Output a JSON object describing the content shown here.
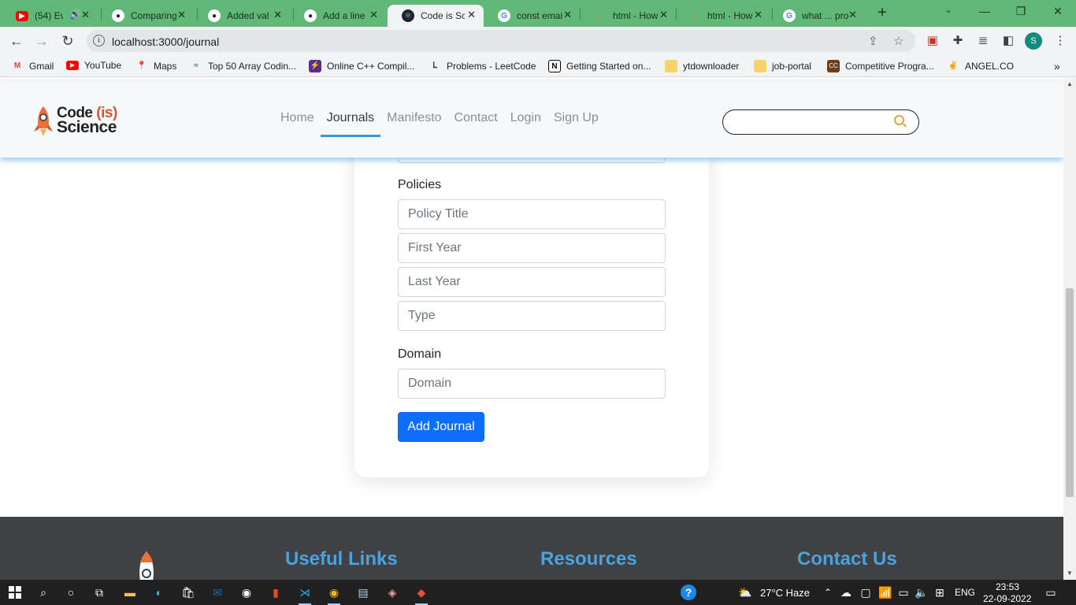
{
  "browser": {
    "tabs": [
      {
        "title": "(54) Ev",
        "icon": "youtube-icon"
      },
      {
        "title": "Comparing",
        "icon": "github-icon"
      },
      {
        "title": "Added val",
        "icon": "github-icon"
      },
      {
        "title": "Add a line",
        "icon": "github-icon"
      },
      {
        "title": "Code is Sci",
        "icon": "react-icon"
      },
      {
        "title": "const emai",
        "icon": "google-icon"
      },
      {
        "title": "html - How",
        "icon": "stackoverflow-icon"
      },
      {
        "title": "html - How",
        "icon": "stackoverflow-icon"
      },
      {
        "title": "what ... pro",
        "icon": "google-icon"
      }
    ],
    "active_tab_index": 4,
    "url": "localhost:3000/journal",
    "profile_initial": "S",
    "bookmarks": [
      {
        "label": "Gmail",
        "icon": "gmail-icon",
        "color": "#ea4335"
      },
      {
        "label": "YouTube",
        "icon": "youtube-icon",
        "color": "#ff0000"
      },
      {
        "label": "Maps",
        "icon": "maps-icon",
        "color": "#34a853"
      },
      {
        "label": "Top 50 Array Codin...",
        "icon": "gfg-icon",
        "color": "#2f8d46"
      },
      {
        "label": "Online C++ Compil...",
        "icon": "compiler-icon",
        "color": "#5b2d90"
      },
      {
        "label": "Problems - LeetCode",
        "icon": "leetcode-icon",
        "color": "#f89f1b"
      },
      {
        "label": "Getting Started on...",
        "icon": "notion-icon",
        "color": "#000000"
      },
      {
        "label": "ytdownloader",
        "icon": "folder-icon",
        "color": "#f6d36b"
      },
      {
        "label": "job-portal",
        "icon": "folder-icon",
        "color": "#f6d36b"
      },
      {
        "label": "Competitive Progra...",
        "icon": "codechef-icon",
        "color": "#6b3f1a"
      },
      {
        "label": "ANGEL.CO",
        "icon": "angel-icon",
        "color": "#555555"
      }
    ]
  },
  "site": {
    "logo": {
      "word1": "Code",
      "word1_paren": "(is)",
      "word2": "Science"
    },
    "nav": [
      "Home",
      "Journals",
      "Manifesto",
      "Contact",
      "Login",
      "Sign Up"
    ],
    "active_nav": "Journals",
    "search_placeholder": ""
  },
  "form": {
    "policies_label": "Policies",
    "policy_title_placeholder": "Policy Title",
    "first_year_placeholder": "First Year",
    "last_year_placeholder": "Last Year",
    "type_placeholder": "Type",
    "domain_label": "Domain",
    "domain_placeholder": "Domain",
    "submit_label": "Add Journal"
  },
  "footer": {
    "useful_links": "Useful Links",
    "resources": "Resources",
    "contact_us": "Contact Us"
  },
  "taskbar": {
    "weather": "27°C Haze",
    "language": "ENG",
    "time": "23:53",
    "date": "22-09-2022"
  },
  "colors": {
    "tabstrip": "#5fb877",
    "accent": "#3498db",
    "primary_button": "#0d6efd",
    "footer_bg": "#3f4144",
    "footer_heading": "#4aa3df"
  }
}
